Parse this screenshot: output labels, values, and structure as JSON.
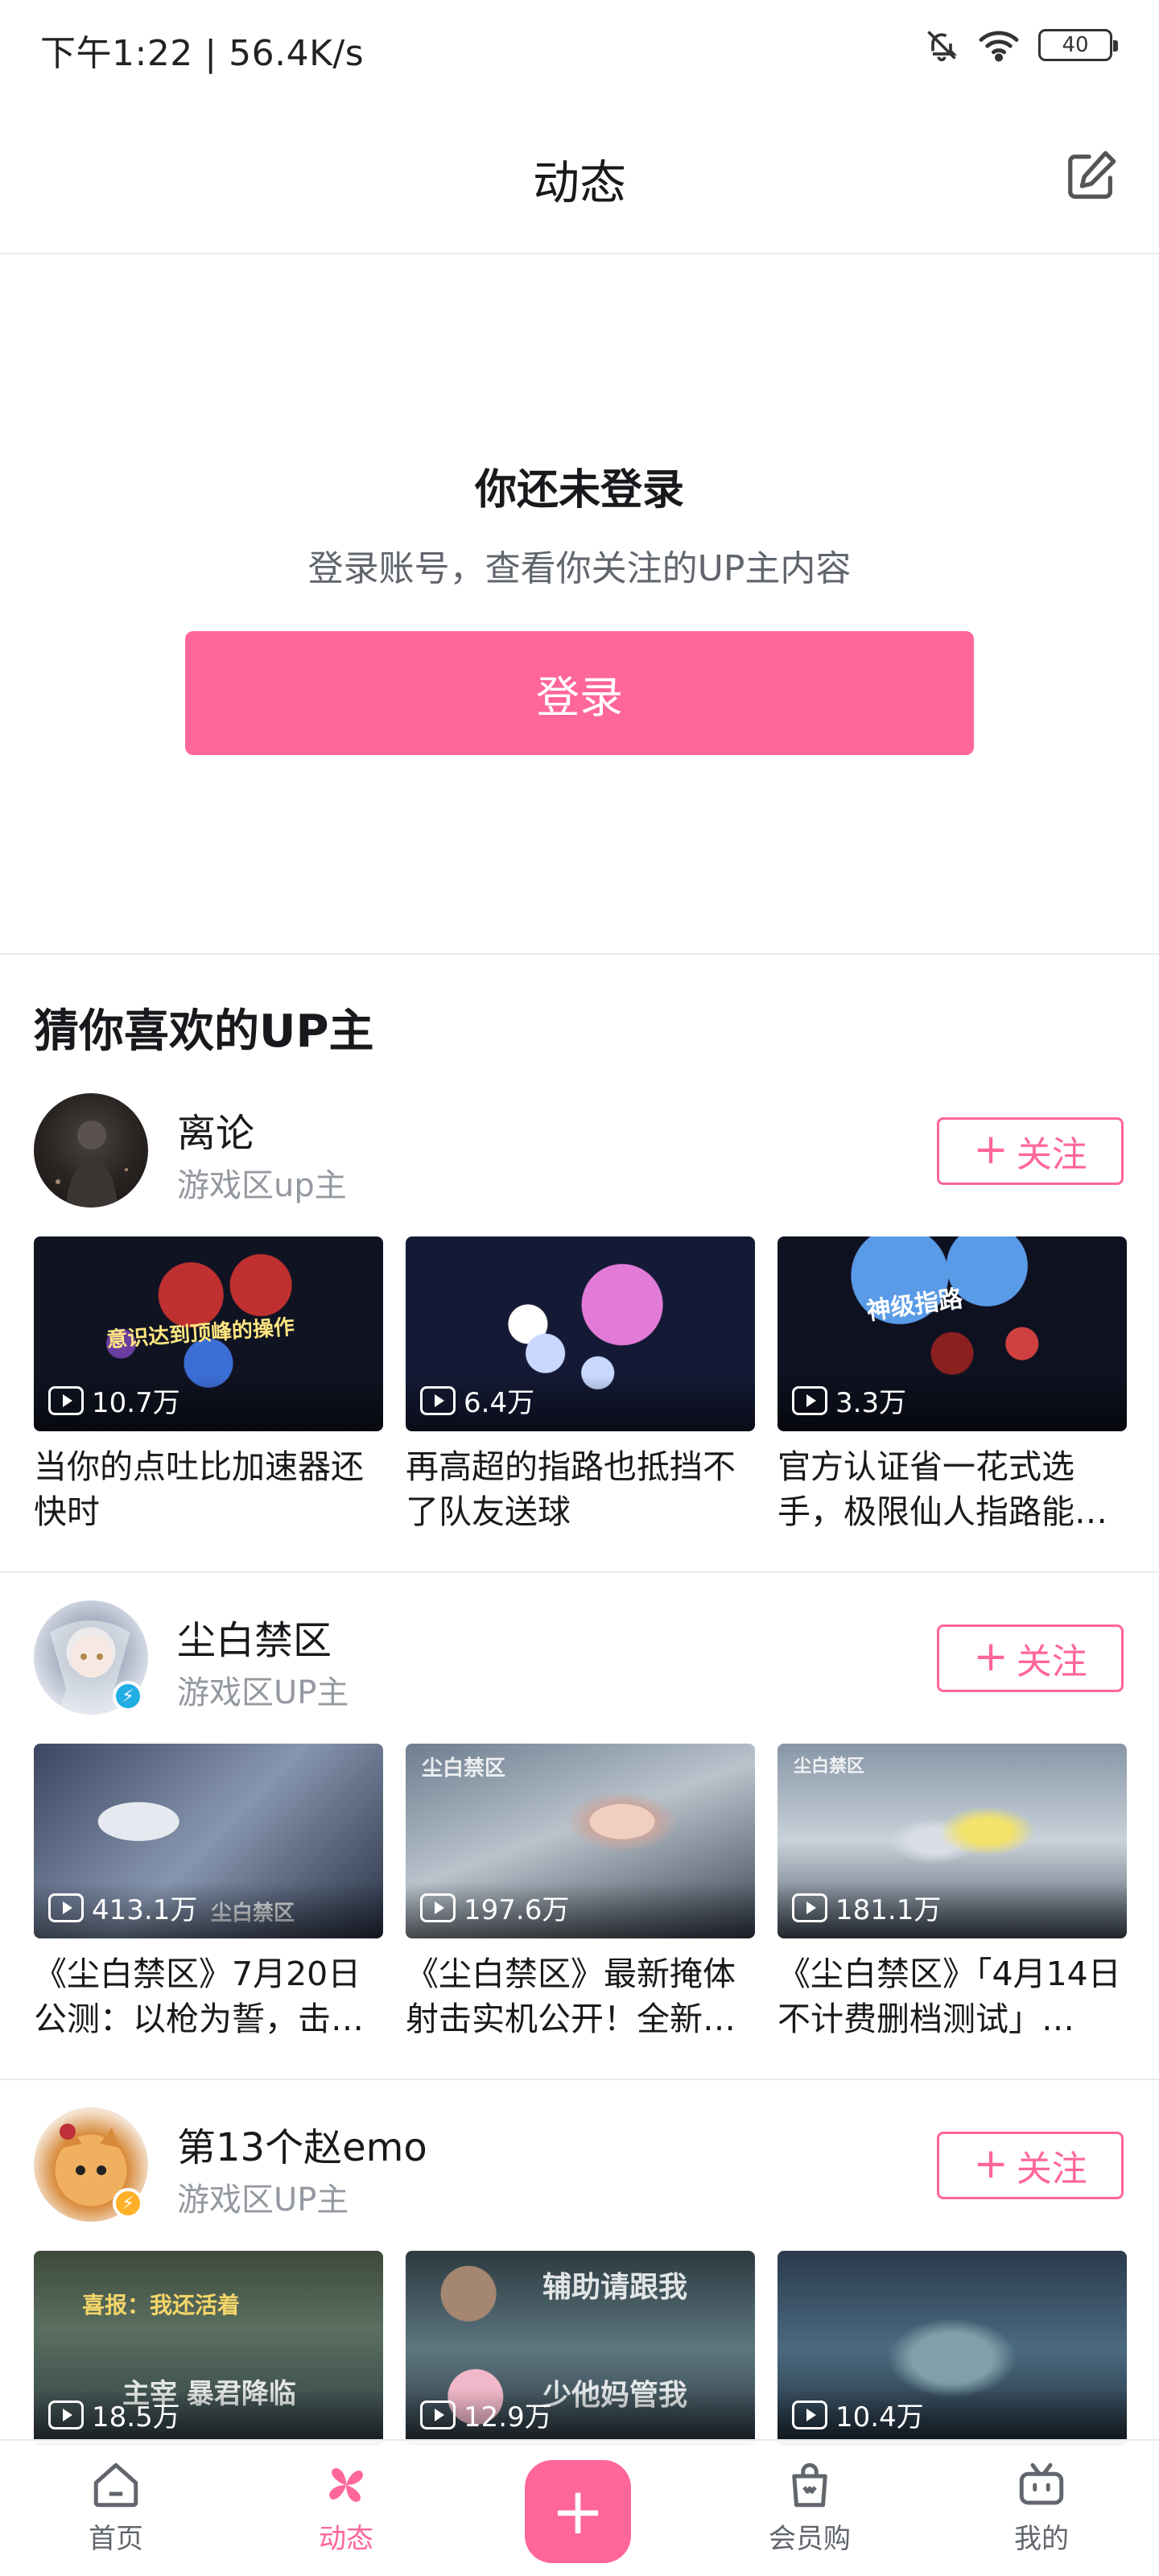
{
  "status_bar": {
    "text": "下午1:22 | 56.4K/s",
    "battery": "40"
  },
  "header": {
    "title": "动态"
  },
  "login": {
    "title": "你还未登录",
    "subtitle": "登录账号，查看你关注的UP主内容",
    "button": "登录"
  },
  "recommend": {
    "title": "猜你喜欢的UP主",
    "follow_label": "关注",
    "ups": [
      {
        "name": "离论",
        "desc": "游戏区up主",
        "videos": [
          {
            "plays": "10.7万",
            "title": "当你的点吐比加速器还快时"
          },
          {
            "plays": "6.4万",
            "title": "再高超的指路也抵挡不了队友送球"
          },
          {
            "plays": "3.3万",
            "title": "官方认证省一花式选手，极限仙人指路能…"
          }
        ]
      },
      {
        "name": "尘白禁区",
        "desc": "游戏区UP主",
        "videos": [
          {
            "plays": "413.1万",
            "title": "《尘白禁区》7月20日公测：以枪为誓，击…"
          },
          {
            "plays": "197.6万",
            "title": "《尘白禁区》最新掩体射击实机公开！全新…"
          },
          {
            "plays": "181.1万",
            "title": "《尘白禁区》「4月14日不计费删档测试」…"
          }
        ]
      },
      {
        "name": "第13个赵emo",
        "desc": "游戏区UP主",
        "videos": [
          {
            "plays": "18.5万",
            "title": ""
          },
          {
            "plays": "12.9万",
            "title": ""
          },
          {
            "plays": "10.4万",
            "title": ""
          }
        ]
      }
    ]
  },
  "thumb_text": {
    "t1": "意识达到顶峰的操作",
    "t4": "尘白禁区",
    "t7a": "喜报：我还活着",
    "t7b": "主宰 暴君降临",
    "t8a": "辅助请跟我",
    "t8b": "少他妈管我",
    "t3": "神级指路"
  },
  "bottom_nav": {
    "home": "首页",
    "dynamic": "动态",
    "mall": "会员购",
    "mine": "我的"
  },
  "colors": {
    "accent": "#ff6699",
    "text": "#18191c",
    "subtext": "#9499a0"
  }
}
